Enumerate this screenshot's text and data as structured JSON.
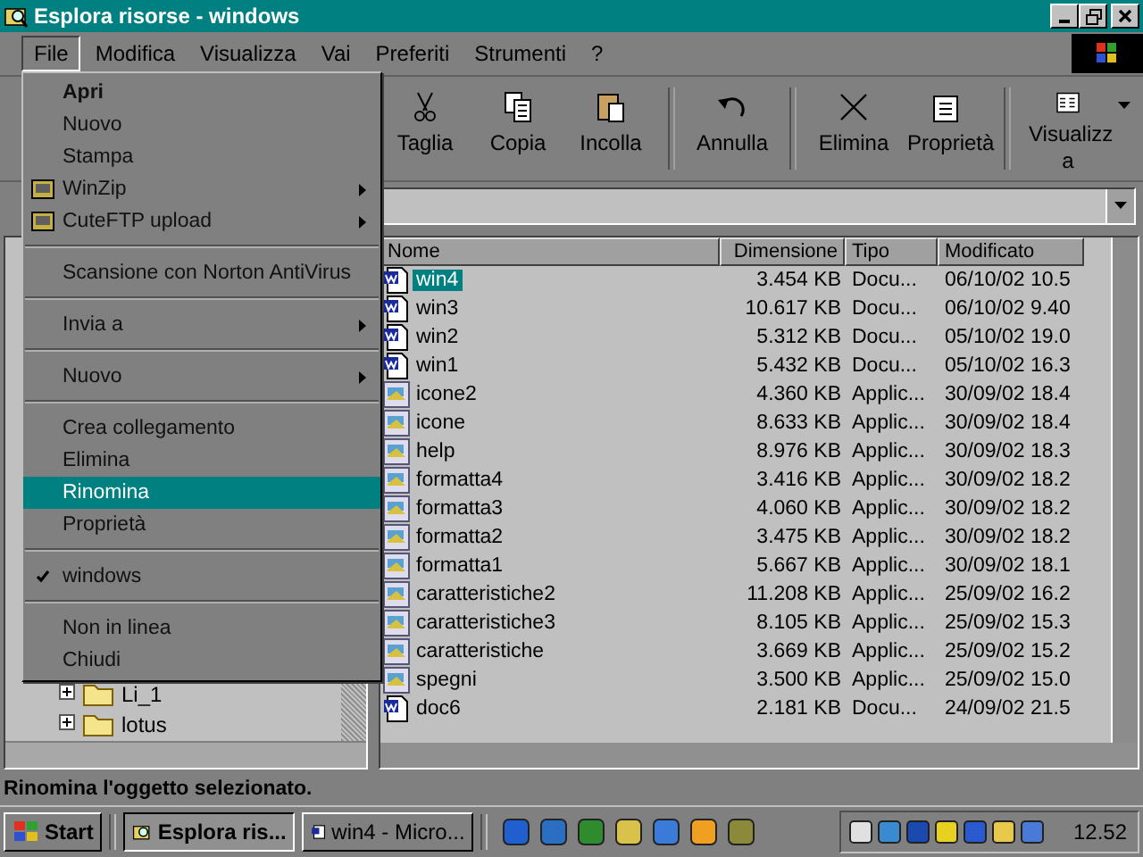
{
  "window": {
    "title": "Esplora risorse - windows"
  },
  "menubar": [
    {
      "label": "File",
      "selected": true
    },
    {
      "label": "Modifica",
      "selected": false
    },
    {
      "label": "Visualizza",
      "selected": false
    },
    {
      "label": "Vai",
      "selected": false
    },
    {
      "label": "Preferiti",
      "selected": false
    },
    {
      "label": "Strumenti",
      "selected": false
    },
    {
      "label": "?",
      "selected": false
    }
  ],
  "toolbar": [
    {
      "kind": "cut",
      "label": "Taglia"
    },
    {
      "kind": "copy",
      "label": "Copia"
    },
    {
      "kind": "paste",
      "label": "Incolla"
    },
    {
      "kind": "undo",
      "label": "Annulla"
    },
    {
      "kind": "delete",
      "label": "Elimina"
    },
    {
      "kind": "properties",
      "label": "Proprietà"
    },
    {
      "kind": "views",
      "label": "Visualizz a"
    }
  ],
  "file_menu": [
    {
      "kind": "item",
      "label": "Apri",
      "default": true,
      "submenu": false,
      "selected": false,
      "checked": false
    },
    {
      "kind": "item",
      "label": "Nuovo",
      "default": false,
      "submenu": false,
      "selected": false,
      "checked": false
    },
    {
      "kind": "item",
      "label": "Stampa",
      "default": false,
      "submenu": false,
      "selected": false,
      "checked": false
    },
    {
      "kind": "app-item",
      "label": "WinZip",
      "default": false,
      "submenu": true,
      "selected": false,
      "checked": false
    },
    {
      "kind": "app-item",
      "label": "CuteFTP upload",
      "default": false,
      "submenu": true,
      "selected": false,
      "checked": false
    },
    {
      "kind": "separator"
    },
    {
      "kind": "item",
      "label": "Scansione con Norton AntiVirus",
      "default": false,
      "submenu": false,
      "selected": false,
      "checked": false
    },
    {
      "kind": "separator"
    },
    {
      "kind": "item",
      "label": "Invia a",
      "default": false,
      "submenu": true,
      "selected": false,
      "checked": false
    },
    {
      "kind": "separator"
    },
    {
      "kind": "item",
      "label": "Nuovo",
      "default": false,
      "submenu": true,
      "selected": false,
      "checked": false
    },
    {
      "kind": "separator"
    },
    {
      "kind": "item",
      "label": "Crea collegamento",
      "default": false,
      "submenu": false,
      "selected": false,
      "checked": false
    },
    {
      "kind": "item",
      "label": "Elimina",
      "default": false,
      "submenu": false,
      "selected": false,
      "checked": false
    },
    {
      "kind": "item",
      "label": "Rinomina",
      "default": false,
      "submenu": false,
      "selected": true,
      "checked": false
    },
    {
      "kind": "item",
      "label": "Proprietà",
      "default": false,
      "submenu": false,
      "selected": false,
      "checked": false
    },
    {
      "kind": "separator"
    },
    {
      "kind": "item",
      "label": "windows",
      "default": false,
      "submenu": false,
      "selected": false,
      "checked": true
    },
    {
      "kind": "separator"
    },
    {
      "kind": "item",
      "label": "Non in linea",
      "default": false,
      "submenu": false,
      "selected": false,
      "checked": false
    },
    {
      "kind": "item",
      "label": "Chiudi",
      "default": false,
      "submenu": false,
      "selected": false,
      "checked": false
    }
  ],
  "folder_tree": [
    {
      "label": "Li_1",
      "expanded": false
    },
    {
      "label": "lotus",
      "expanded": false
    }
  ],
  "file_list": {
    "columns": [
      "Nome",
      "Dimensione",
      "Tipo",
      "Modificato"
    ],
    "rows": [
      {
        "kind": "document",
        "name": "win4",
        "size": "3.454 KB",
        "type": "Docu...",
        "modified": "06/10/02 10.5",
        "selected": true
      },
      {
        "kind": "document",
        "name": "win3",
        "size": "10.617 KB",
        "type": "Docu...",
        "modified": "06/10/02 9.40",
        "selected": false
      },
      {
        "kind": "document",
        "name": "win2",
        "size": "5.312 KB",
        "type": "Docu...",
        "modified": "05/10/02 19.0",
        "selected": false
      },
      {
        "kind": "document",
        "name": "win1",
        "size": "5.432 KB",
        "type": "Docu...",
        "modified": "05/10/02 16.3",
        "selected": false
      },
      {
        "kind": "application",
        "name": "icone2",
        "size": "4.360 KB",
        "type": "Applic...",
        "modified": "30/09/02 18.4",
        "selected": false
      },
      {
        "kind": "application",
        "name": "icone",
        "size": "8.633 KB",
        "type": "Applic...",
        "modified": "30/09/02 18.4",
        "selected": false
      },
      {
        "kind": "application",
        "name": "help",
        "size": "8.976 KB",
        "type": "Applic...",
        "modified": "30/09/02 18.3",
        "selected": false
      },
      {
        "kind": "application",
        "name": "formatta4",
        "size": "3.416 KB",
        "type": "Applic...",
        "modified": "30/09/02 18.2",
        "selected": false
      },
      {
        "kind": "application",
        "name": "formatta3",
        "size": "4.060 KB",
        "type": "Applic...",
        "modified": "30/09/02 18.2",
        "selected": false
      },
      {
        "kind": "application",
        "name": "formatta2",
        "size": "3.475 KB",
        "type": "Applic...",
        "modified": "30/09/02 18.2",
        "selected": false
      },
      {
        "kind": "application",
        "name": "formatta1",
        "size": "5.667 KB",
        "type": "Applic...",
        "modified": "30/09/02 18.1",
        "selected": false
      },
      {
        "kind": "application",
        "name": "caratteristiche2",
        "size": "11.208 KB",
        "type": "Applic...",
        "modified": "25/09/02 16.2",
        "selected": false
      },
      {
        "kind": "application",
        "name": "caratteristiche3",
        "size": "8.105 KB",
        "type": "Applic...",
        "modified": "25/09/02 15.3",
        "selected": false
      },
      {
        "kind": "application",
        "name": "caratteristiche",
        "size": "3.669 KB",
        "type": "Applic...",
        "modified": "25/09/02 15.2",
        "selected": false
      },
      {
        "kind": "application",
        "name": "spegni",
        "size": "3.500 KB",
        "type": "Applic...",
        "modified": "25/09/02 15.0",
        "selected": false
      },
      {
        "kind": "document",
        "name": "doc6",
        "size": "2.181 KB",
        "type": "Docu...",
        "modified": "24/09/02 21.5",
        "selected": false
      }
    ]
  },
  "status_bar": "Rinomina l'oggetto selezionato.",
  "taskbar": {
    "start": "Start",
    "tasks": [
      {
        "kind": "explorer",
        "label": "Esplora ris...",
        "selected": true
      },
      {
        "kind": "word",
        "label": "win4 - Micro...",
        "selected": false
      }
    ],
    "clock": "12.52"
  }
}
